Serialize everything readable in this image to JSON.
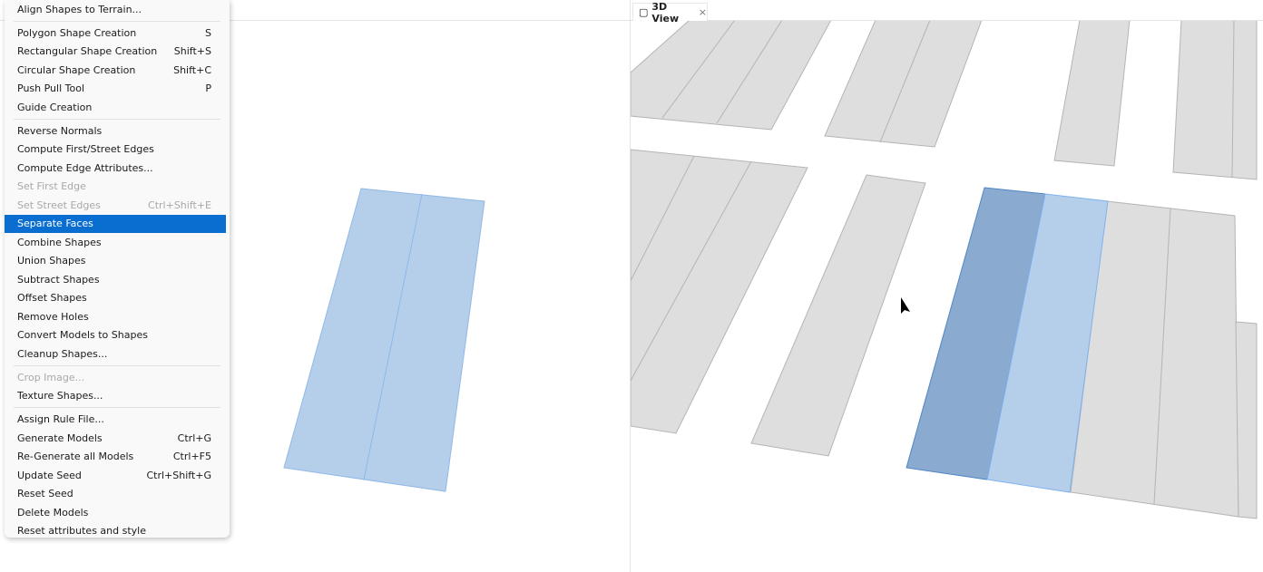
{
  "tab": {
    "label": "3D View",
    "icon": "cube-icon",
    "close": "×"
  },
  "menu": {
    "groups": [
      [
        {
          "label": "Align Shapes to Terrain...",
          "shortcut": ""
        }
      ],
      [
        {
          "label": "Polygon Shape Creation",
          "shortcut": "S"
        },
        {
          "label": "Rectangular Shape Creation",
          "shortcut": "Shift+S"
        },
        {
          "label": "Circular Shape Creation",
          "shortcut": "Shift+C"
        },
        {
          "label": "Push Pull Tool",
          "shortcut": "P"
        },
        {
          "label": "Guide Creation",
          "shortcut": ""
        }
      ],
      [
        {
          "label": "Reverse Normals",
          "shortcut": ""
        },
        {
          "label": "Compute First/Street Edges",
          "shortcut": ""
        },
        {
          "label": "Compute Edge Attributes...",
          "shortcut": ""
        },
        {
          "label": "Set First Edge",
          "shortcut": "",
          "disabled": true
        },
        {
          "label": "Set Street Edges",
          "shortcut": "Ctrl+Shift+E",
          "disabled": true
        },
        {
          "label": "Separate Faces",
          "shortcut": "",
          "active": true
        },
        {
          "label": "Combine Shapes",
          "shortcut": ""
        },
        {
          "label": "Union Shapes",
          "shortcut": ""
        },
        {
          "label": "Subtract Shapes",
          "shortcut": ""
        },
        {
          "label": "Offset Shapes",
          "shortcut": ""
        },
        {
          "label": "Remove Holes",
          "shortcut": ""
        },
        {
          "label": "Convert Models to Shapes",
          "shortcut": ""
        },
        {
          "label": "Cleanup Shapes...",
          "shortcut": ""
        }
      ],
      [
        {
          "label": "Crop Image...",
          "shortcut": "",
          "disabled": true
        },
        {
          "label": "Texture Shapes...",
          "shortcut": ""
        }
      ],
      [
        {
          "label": "Assign Rule File...",
          "shortcut": ""
        },
        {
          "label": "Generate Models",
          "shortcut": "Ctrl+G"
        },
        {
          "label": "Re-Generate all Models",
          "shortcut": "Ctrl+F5"
        },
        {
          "label": "Update Seed",
          "shortcut": "Ctrl+Shift+G"
        },
        {
          "label": "Reset Seed",
          "shortcut": ""
        },
        {
          "label": "Delete Models",
          "shortcut": ""
        },
        {
          "label": "Reset attributes and style",
          "shortcut": ""
        }
      ]
    ]
  },
  "colors": {
    "highlight": "#0a6ed1",
    "selected_face": "#8aabcf",
    "face": "#b5cfea",
    "building_lot": "#dedede"
  }
}
